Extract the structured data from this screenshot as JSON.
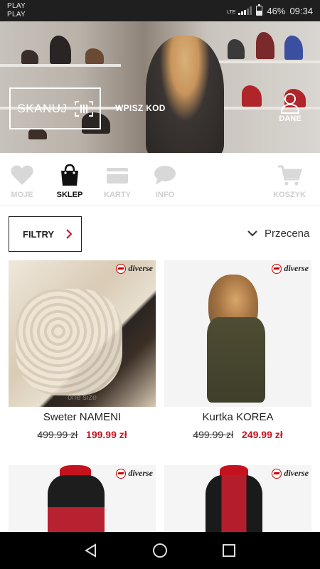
{
  "status_bar": {
    "carrier_1": "PLAY",
    "carrier_2": "PLAY",
    "network": "LTE",
    "battery": "46%",
    "time": "09:34"
  },
  "hero": {
    "scan_label": "SKANUJ",
    "enter_code_label": "WPISZ KOD",
    "account_label": "DANE"
  },
  "tabs": [
    {
      "label": "MOJE",
      "icon": "heart-icon",
      "active": false
    },
    {
      "label": "SKLEP",
      "icon": "shopping-bag-icon",
      "active": true
    },
    {
      "label": "KARTY",
      "icon": "card-icon",
      "active": false
    },
    {
      "label": "INFO",
      "icon": "chat-bubble-icon",
      "active": false
    },
    {
      "label": "KOSZYK",
      "icon": "cart-icon",
      "active": false
    }
  ],
  "filters": {
    "filter_label": "FILTRY",
    "sort_label": "Przecena"
  },
  "brand_name": "diverse",
  "products": [
    {
      "name": "Sweter NAMENI",
      "old_price": "499.99 zł",
      "new_price": "199.99 zł",
      "size_note": "one size"
    },
    {
      "name": "Kurtka KOREA",
      "old_price": "499.99 zł",
      "new_price": "249.99 zł",
      "size_note": ""
    },
    {
      "name": "",
      "old_price": "",
      "new_price": "",
      "size_note": ""
    },
    {
      "name": "",
      "old_price": "",
      "new_price": "",
      "size_note": ""
    }
  ],
  "colors": {
    "accent_red": "#c4131f",
    "active_tab": "#111111",
    "inactive_tab": "#cfcfcf"
  }
}
